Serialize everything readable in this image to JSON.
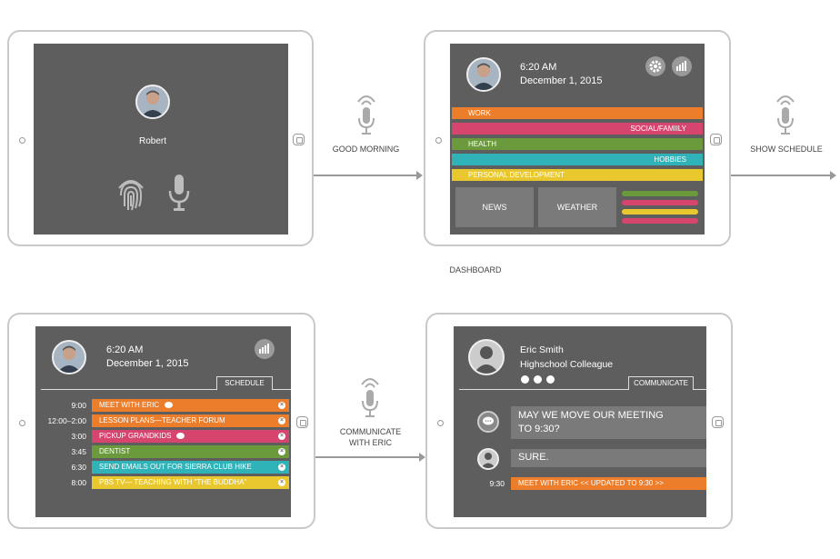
{
  "login": {
    "name": "Robert"
  },
  "voice1": {
    "label": "GOOD MORNING"
  },
  "voice2": {
    "label": "SHOW SCHEDULE"
  },
  "voice3": {
    "label": "COMMUNICATE\nWITH ERIC"
  },
  "dashboard": {
    "time": "6:20 AM",
    "date": "December 1, 2015",
    "caption": "DASHBOARD",
    "categories": [
      {
        "label": "WORK",
        "color": "#ec7d2b",
        "align": "left"
      },
      {
        "label": "SOCIAL/FAMIILY",
        "color": "#d6456e",
        "align": "right"
      },
      {
        "label": "HEALTH",
        "color": "#6b9a3d",
        "align": "left"
      },
      {
        "label": "HOBBIES",
        "color": "#2fb3b8",
        "align": "right"
      },
      {
        "label": "PERSONAL DEVELOPMENT",
        "color": "#e8c82e",
        "align": "left"
      }
    ],
    "tiles": {
      "news": "NEWS",
      "weather": "WEATHER"
    },
    "mini_bars": [
      "#6b9a3d",
      "#d6456e",
      "#e8c82e",
      "#d6456e"
    ]
  },
  "schedule": {
    "time": "6:20 AM",
    "date": "December 1, 2015",
    "tab": "SCHEDULE",
    "rows": [
      {
        "time": "9:00",
        "label": "MEET WITH  ERIC",
        "color": "#ec7d2b",
        "chat": true
      },
      {
        "time": "12:00–2:00",
        "label": "LESSON PLANS—TEACHER FORUM",
        "color": "#ec7d2b",
        "chat": false
      },
      {
        "time": "3:00",
        "label": "PICKUP GRANDKIDS",
        "color": "#d6456e",
        "chat": true
      },
      {
        "time": "3:45",
        "label": "DENTIST",
        "color": "#6b9a3d",
        "chat": false
      },
      {
        "time": "6:30",
        "label": "SEND EMAILS OUT FOR SIERRA CLUB HIKE",
        "color": "#2fb3b8",
        "chat": false
      },
      {
        "time": "8:00",
        "label": "PBS TV— TEACHING WITH \"THE BUDDHA\"",
        "color": "#e8c82e",
        "chat": false
      }
    ]
  },
  "communicate": {
    "name": "Eric Smith",
    "role": "Highschool Colleague",
    "tab": "COMMUNICATE",
    "message_in": "MAY WE MOVE OUR MEETING\nTO 9:30?",
    "message_out": "SURE.",
    "update_time": "9:30",
    "update_label": "MEET WITH ERIC << UPDATED  TO 9:30 >>",
    "update_color": "#ec7d2b"
  }
}
